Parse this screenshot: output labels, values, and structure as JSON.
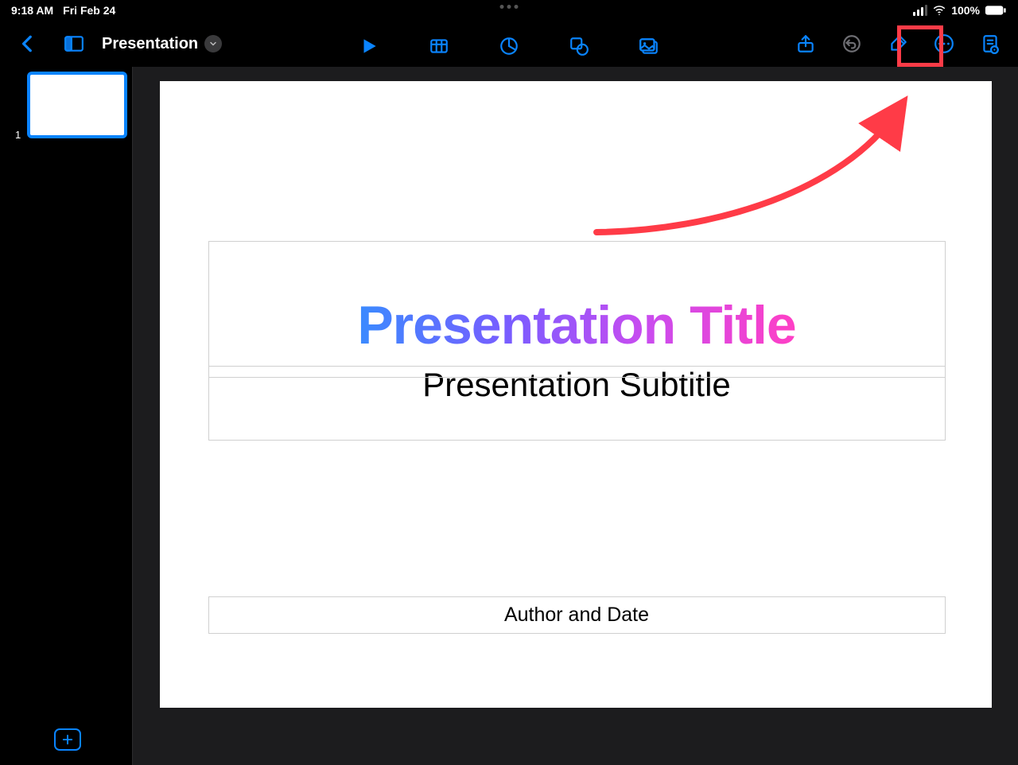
{
  "status": {
    "time": "9:18 AM",
    "date": "Fri Feb 24",
    "battery_pct": "100%"
  },
  "header": {
    "doc_title": "Presentation",
    "icons": {
      "back": "back-chevron-icon",
      "sidebar": "sidebar-toggle-icon",
      "play": "play-icon",
      "table": "table-icon",
      "chart": "chart-icon",
      "shape": "shape-icon",
      "media": "media-icon",
      "share": "share-icon",
      "undo": "undo-icon",
      "format": "format-brush-icon",
      "more": "more-icon",
      "document": "document-options-icon"
    }
  },
  "sidebar": {
    "slides": [
      {
        "index": "1"
      }
    ]
  },
  "slide": {
    "title": "Presentation Title",
    "subtitle": "Presentation Subtitle",
    "author": "Author and Date"
  },
  "annotation": {
    "target": "more-button",
    "color": "#ff3b47"
  }
}
